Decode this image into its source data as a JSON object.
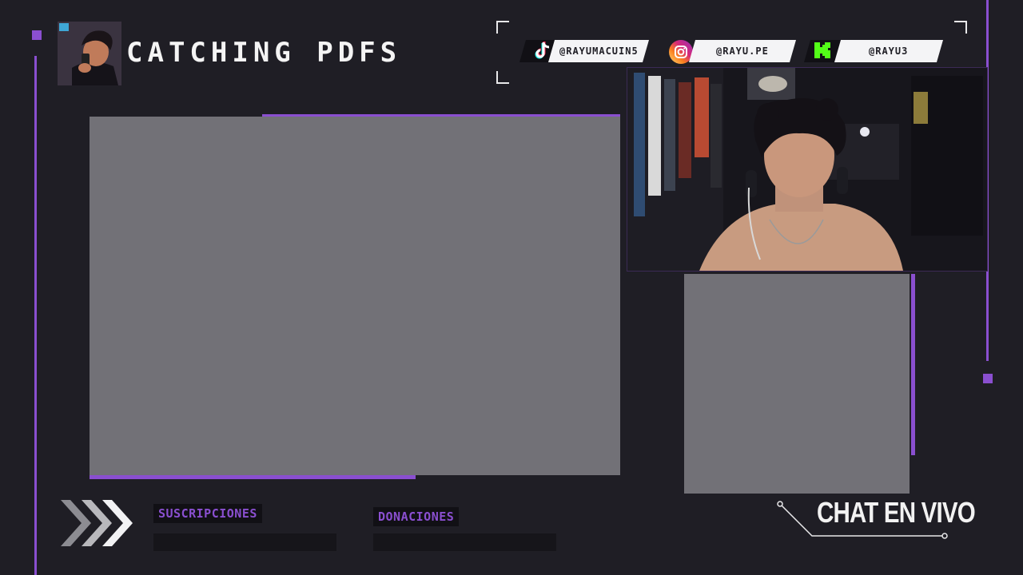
{
  "stream": {
    "title": "CATCHING PDFS",
    "avatar_icon": "streamer-avatar-icon"
  },
  "socials": [
    {
      "platform_icon": "tiktok-icon",
      "handle": "@RAYUMACUIN5"
    },
    {
      "platform_icon": "instagram-icon",
      "handle": "@RAYU.PE"
    },
    {
      "platform_icon": "kick-icon",
      "handle": "@RAYU3"
    }
  ],
  "goals": {
    "subs_label": "SUSCRIPCIONES",
    "donations_label": "DONACIONES"
  },
  "chat": {
    "title": "CHAT EN VIVO"
  },
  "colors": {
    "background": "#1f1e25",
    "accent": "#8a4fd0",
    "screen": "#727177"
  }
}
